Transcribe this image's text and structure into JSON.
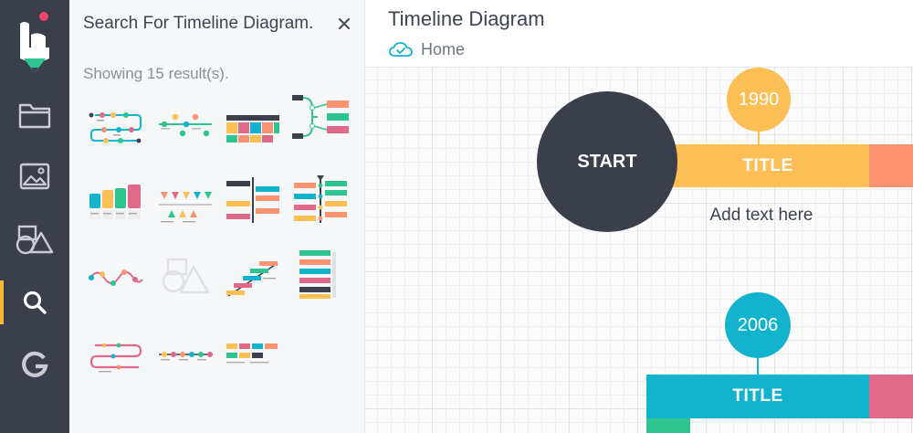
{
  "panel": {
    "title": "Search For Timeline Diagram.",
    "result_count": "Showing 15 result(s)."
  },
  "document": {
    "title": "Timeline Diagram",
    "breadcrumb": "Home"
  },
  "diagram": {
    "start_label": "START",
    "first_year": "1990",
    "first_title": "TITLE",
    "first_note": "Add text here",
    "second_year": "2006",
    "second_title": "TITLE"
  },
  "icons": {
    "rail": [
      "app-logo-icon",
      "folder-icon",
      "image-icon",
      "shapes-icon",
      "search-icon",
      "google-icon"
    ],
    "close": "close-icon",
    "breadcrumb": "cloud-check-icon"
  },
  "colors": {
    "rail": "#3a3f4b",
    "active_accent": "#f7b731",
    "yellow": "#fcbf56",
    "orange": "#fb9370",
    "cyan": "#14b3cd",
    "pink": "#e0698a",
    "green": "#2ec38f",
    "dark": "#3b3f4c"
  }
}
